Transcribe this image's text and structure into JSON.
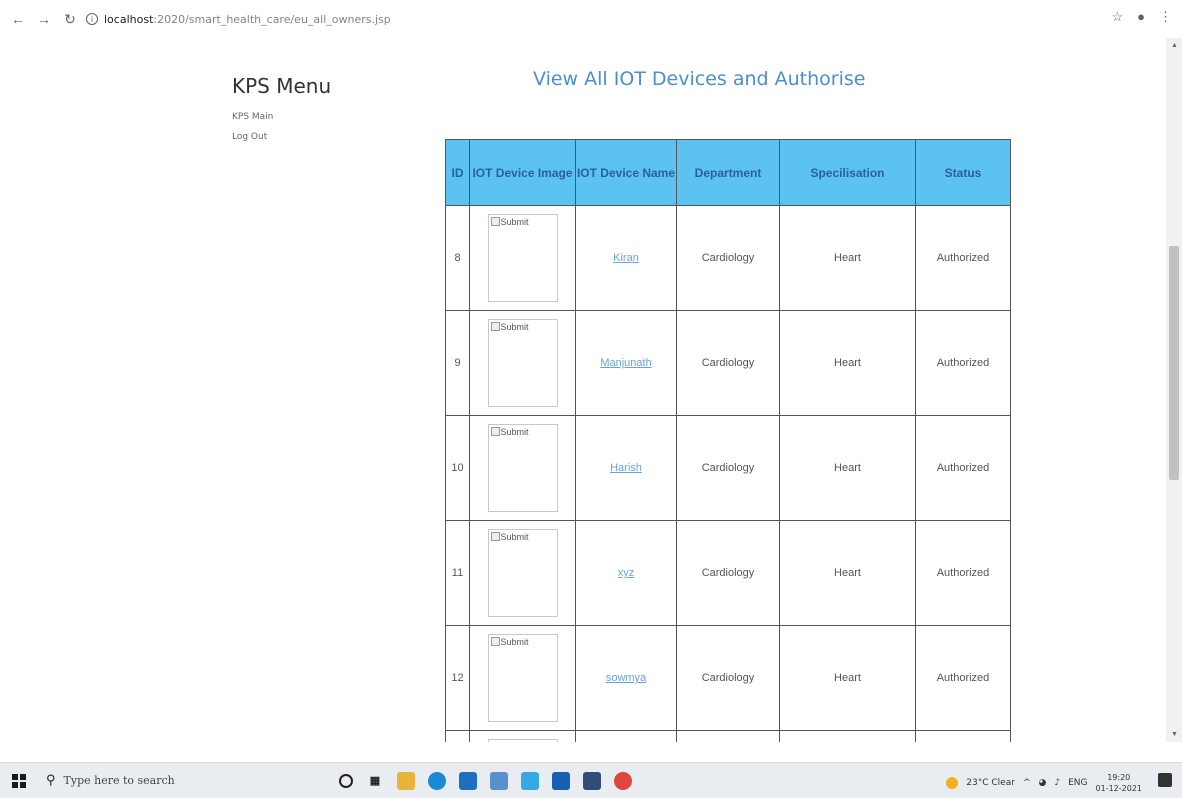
{
  "browser": {
    "url_host": "localhost",
    "url_path": ":2020/smart_health_care/eu_all_owners.jsp",
    "back_icon": "back-arrow-icon",
    "forward_icon": "forward-arrow-icon",
    "reload_icon": "reload-icon"
  },
  "sidebar": {
    "title": "KPS Menu",
    "items": [
      {
        "label": "KPS Main"
      },
      {
        "label": "Log Out"
      }
    ]
  },
  "main": {
    "heading": "View All IOT Devices and Authorise",
    "table": {
      "headers": [
        "ID",
        "IOT Device Image",
        "IOT Device Name",
        "Department",
        "Specilisation",
        "Status"
      ],
      "image_alt": "Submit",
      "rows": [
        {
          "id": "8",
          "name": "Kiran",
          "department": "Cardiology",
          "specialisation": "Heart",
          "status": "Authorized"
        },
        {
          "id": "9",
          "name": "Manjunath",
          "department": "Cardiology",
          "specialisation": "Heart",
          "status": "Authorized"
        },
        {
          "id": "10",
          "name": "Harish",
          "department": "Cardiology",
          "specialisation": "Heart",
          "status": "Authorized"
        },
        {
          "id": "11",
          "name": "xyz",
          "department": "Cardiology",
          "specialisation": "Heart",
          "status": "Authorized"
        },
        {
          "id": "12",
          "name": "sowmya",
          "department": "Cardiology",
          "specialisation": "Heart",
          "status": "Authorized"
        }
      ]
    }
  },
  "taskbar": {
    "search_placeholder": "Type here to search",
    "weather": "23°C Clear",
    "language": "ENG",
    "time": "19:20",
    "date": "01-12-2021"
  },
  "colors": {
    "header_bg": "#5cc2f2",
    "heading": "#4a90c9",
    "link": "#6aa3d8"
  }
}
